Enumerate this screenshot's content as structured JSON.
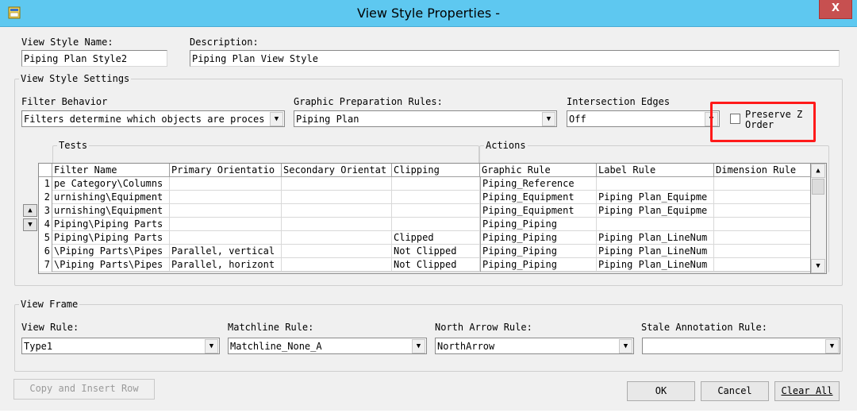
{
  "window": {
    "title": "View Style Properties -",
    "close_label": "X"
  },
  "name_desc": {
    "name_label": "View Style Name:",
    "name_value": "Piping Plan Style2",
    "desc_label": "Description:",
    "desc_value": "Piping Plan View Style"
  },
  "settings": {
    "group_title": "View Style Settings",
    "filter_behavior_label": "Filter Behavior",
    "filter_behavior_value": "Filters determine which objects are proces",
    "graphic_prep_label": "Graphic Preparation Rules:",
    "graphic_prep_value": "Piping Plan",
    "intersection_label": "Intersection Edges",
    "intersection_value": "Off",
    "preserve_z_label_line1": "Preserve Z",
    "preserve_z_label_line2": "Order",
    "preserve_z_checked": false,
    "tests_title": "Tests",
    "actions_title": "Actions"
  },
  "grid": {
    "columns": [
      "Filter Name",
      "Primary Orientatio",
      "Secondary Orientat",
      "Clipping",
      "Graphic Rule",
      "Label Rule",
      "Dimension Rule"
    ],
    "rows": [
      {
        "n": "1",
        "cells": [
          "pe Category\\Columns",
          "",
          "",
          "",
          "Piping_Reference",
          "",
          ""
        ]
      },
      {
        "n": "2",
        "cells": [
          "urnishing\\Equipment",
          "",
          "",
          "",
          "Piping_Equipment",
          "Piping Plan_Equipme",
          ""
        ]
      },
      {
        "n": "3",
        "cells": [
          "urnishing\\Equipment",
          "",
          "",
          "",
          "Piping_Equipment",
          "Piping Plan_Equipme",
          ""
        ]
      },
      {
        "n": "4",
        "cells": [
          "Piping\\Piping Parts",
          "",
          "",
          "",
          "Piping_Piping",
          "",
          ""
        ]
      },
      {
        "n": "5",
        "cells": [
          "Piping\\Piping Parts",
          "",
          "",
          "Clipped",
          "Piping_Piping",
          "Piping Plan_LineNum",
          ""
        ]
      },
      {
        "n": "6",
        "cells": [
          "\\Piping Parts\\Pipes",
          "Parallel, vertical",
          "",
          "Not Clipped",
          "Piping_Piping",
          "Piping Plan_LineNum",
          ""
        ]
      },
      {
        "n": "7",
        "cells": [
          "\\Piping Parts\\Pipes",
          "Parallel, horizont",
          "",
          "Not Clipped",
          "Piping_Piping",
          "Piping Plan_LineNum",
          ""
        ]
      }
    ],
    "move_up_icon": "triangle-up-icon",
    "move_down_icon": "triangle-down-icon"
  },
  "view_frame": {
    "group_title": "View Frame",
    "view_rule_label": "View Rule:",
    "view_rule_value": "Type1",
    "matchline_label": "Matchline Rule:",
    "matchline_value": "Matchline_None_A",
    "north_arrow_label": "North Arrow Rule:",
    "north_arrow_value": "NorthArrow",
    "stale_label": "Stale Annotation Rule:",
    "stale_value": ""
  },
  "buttons": {
    "copy_insert": "Copy and Insert Row",
    "ok": "OK",
    "cancel": "Cancel",
    "clear_all": "Clear All"
  },
  "colors": {
    "titlebar": "#5ec8f0",
    "close": "#c75050",
    "highlight_box": "#ff1a1a"
  }
}
